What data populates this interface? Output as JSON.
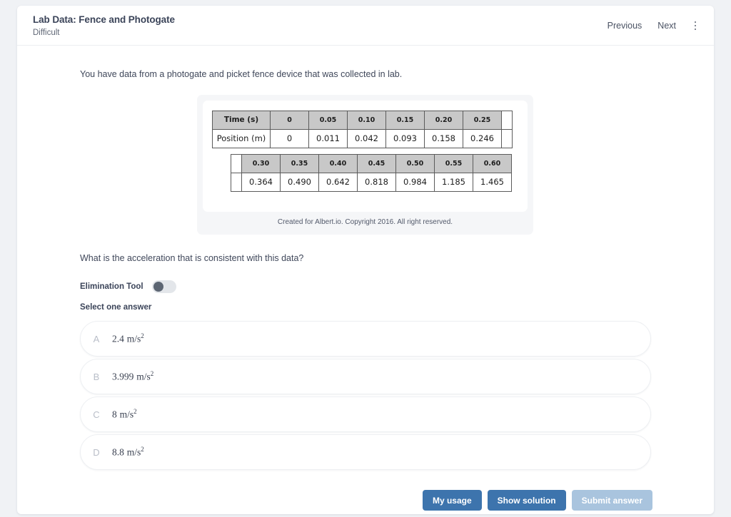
{
  "header": {
    "title": "Lab Data: Fence and Photogate",
    "difficulty": "Difficult",
    "previous_label": "Previous",
    "next_label": "Next",
    "menu_icon": "kebab-menu-icon"
  },
  "body": {
    "intro_text": "You have data from a photogate and picket fence device that was collected in lab.",
    "question_text": "What is the acceleration that is consistent with this data?",
    "elimination_label": "Elimination Tool",
    "elimination_enabled": false,
    "select_prompt": "Select one answer"
  },
  "figure": {
    "caption": "Created for Albert.io. Copyright 2016. All right reserved.",
    "table_one": {
      "row_labels": [
        "Time (s)",
        "Position (m)"
      ],
      "time": [
        "0",
        "0.05",
        "0.10",
        "0.15",
        "0.20",
        "0.25"
      ],
      "position": [
        "0",
        "0.011",
        "0.042",
        "0.093",
        "0.158",
        "0.246"
      ]
    },
    "table_two": {
      "time": [
        "0.30",
        "0.35",
        "0.40",
        "0.45",
        "0.50",
        "0.55",
        "0.60"
      ],
      "position": [
        "0.364",
        "0.490",
        "0.642",
        "0.818",
        "0.984",
        "1.185",
        "1.465"
      ]
    }
  },
  "answers": [
    {
      "letter": "A",
      "number": "2.4",
      "unit_num": "m",
      "unit_den": "s",
      "exponent": "2"
    },
    {
      "letter": "B",
      "number": "3.999",
      "unit_num": "m",
      "unit_den": "s",
      "exponent": "2"
    },
    {
      "letter": "C",
      "number": "8",
      "unit_num": "m",
      "unit_den": "s",
      "exponent": "2"
    },
    {
      "letter": "D",
      "number": "8.8",
      "unit_num": "m",
      "unit_den": "s",
      "exponent": "2"
    }
  ],
  "footer": {
    "my_usage_label": "My usage",
    "show_solution_label": "Show solution",
    "submit_label": "Submit answer",
    "submit_disabled": true
  },
  "colors": {
    "page_background": "#f0f2f5",
    "card_background": "#ffffff",
    "primary_button": "#3d74ad",
    "disabled_button": "#a9c4de",
    "text_primary": "#3b4459",
    "table_header": "#c8c8c8"
  }
}
